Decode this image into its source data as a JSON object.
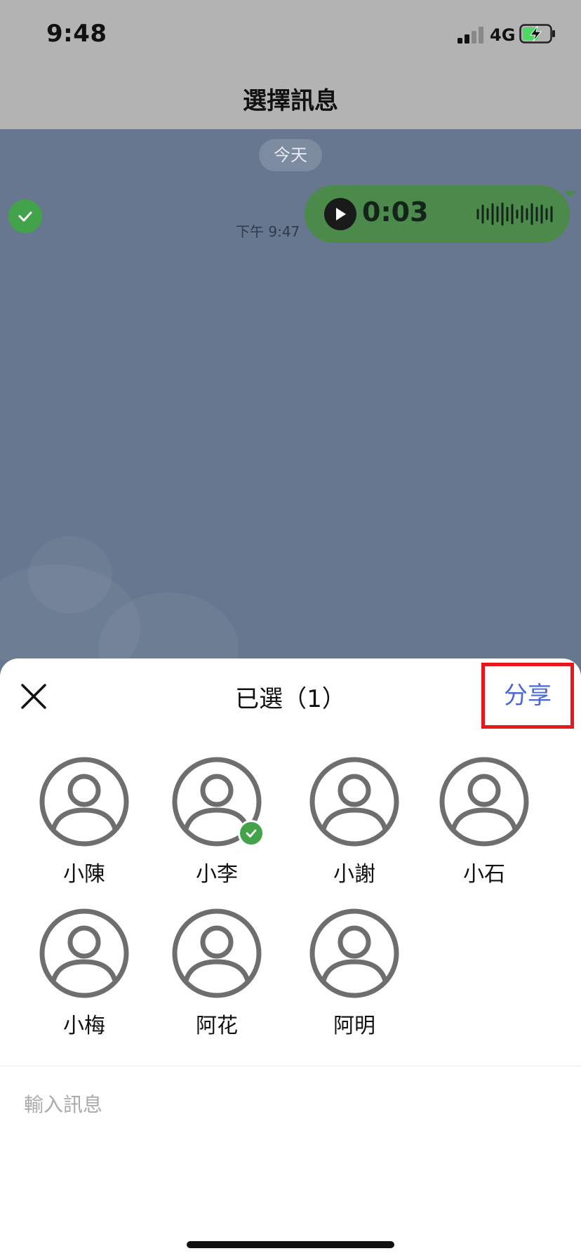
{
  "status_bar": {
    "time": "9:48",
    "network": "4G"
  },
  "nav": {
    "title": "選擇訊息"
  },
  "chat": {
    "date_label": "今天",
    "messages": [
      {
        "type": "voice",
        "duration": "0:03",
        "time": "下午 9:47",
        "selected": true
      }
    ]
  },
  "sheet": {
    "title": "已選（1）",
    "share_label": "分享",
    "contacts": [
      {
        "name": "小陳",
        "selected": false
      },
      {
        "name": "小李",
        "selected": true
      },
      {
        "name": "小謝",
        "selected": false
      },
      {
        "name": "小石",
        "selected": false
      },
      {
        "name": "小梅",
        "selected": false
      },
      {
        "name": "阿花",
        "selected": false
      },
      {
        "name": "阿明",
        "selected": false
      }
    ],
    "input_placeholder": "輸入訊息"
  },
  "icons": {
    "close": "close-icon",
    "share_highlight_color": "#e8171c",
    "accent": "#4b6ad1",
    "check_green": "#43a34a",
    "bubble_green": "#4c8a4c"
  }
}
